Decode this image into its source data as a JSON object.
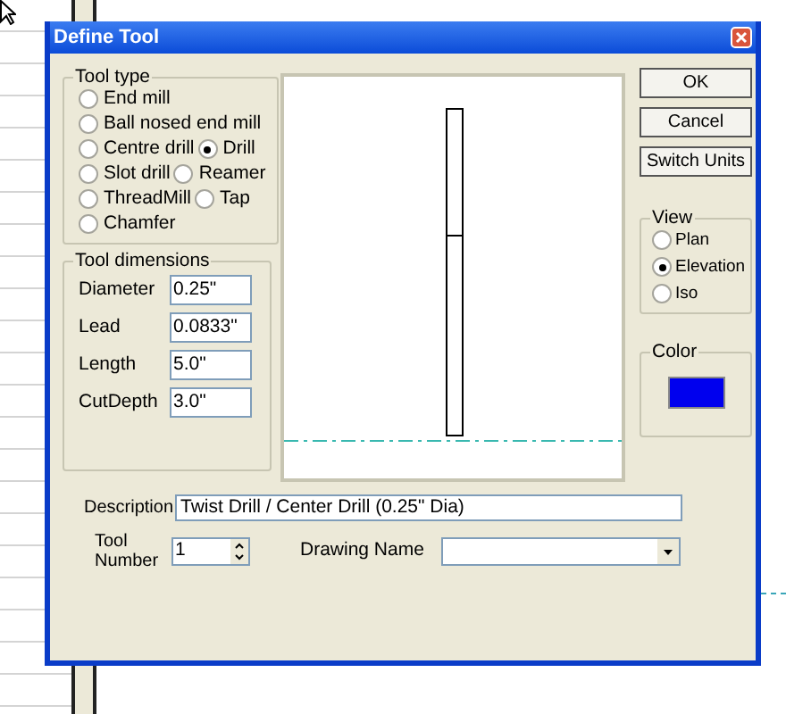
{
  "window": {
    "title": "Define Tool"
  },
  "tool_type": {
    "title": "Tool type",
    "rows": [
      [
        {
          "label": "End mill",
          "selected": false
        }
      ],
      [
        {
          "label": "Ball nosed end mill",
          "selected": false
        }
      ],
      [
        {
          "label": "Centre drill",
          "selected": false
        },
        {
          "label": "Drill",
          "selected": true
        }
      ],
      [
        {
          "label": "Slot drill",
          "selected": false
        },
        {
          "label": "Reamer",
          "selected": false
        }
      ],
      [
        {
          "label": "ThreadMill",
          "selected": false
        },
        {
          "label": "Tap",
          "selected": false
        }
      ],
      [
        {
          "label": "Chamfer",
          "selected": false
        }
      ]
    ]
  },
  "tool_dimensions": {
    "title": "Tool dimensions",
    "fields": [
      {
        "label": "Diameter",
        "value": "0.25\""
      },
      {
        "label": "Lead",
        "value": "0.0833\""
      },
      {
        "label": "Length",
        "value": "5.0\""
      },
      {
        "label": "CutDepth",
        "value": "3.0\""
      }
    ]
  },
  "buttons": [
    "OK",
    "Cancel",
    "Switch Units"
  ],
  "view": {
    "title": "View",
    "options": [
      {
        "label": "Plan",
        "selected": false
      },
      {
        "label": "Elevation",
        "selected": true
      },
      {
        "label": "Iso",
        "selected": false
      }
    ]
  },
  "color": {
    "title": "Color",
    "color": "#0000ee"
  },
  "description": {
    "label": "Description",
    "value": "Twist Drill / Center Drill (0.25\" Dia)"
  },
  "tool_number": {
    "label": "Tool Number",
    "value": "1"
  },
  "drawing_name": {
    "label": "Drawing Name"
  }
}
